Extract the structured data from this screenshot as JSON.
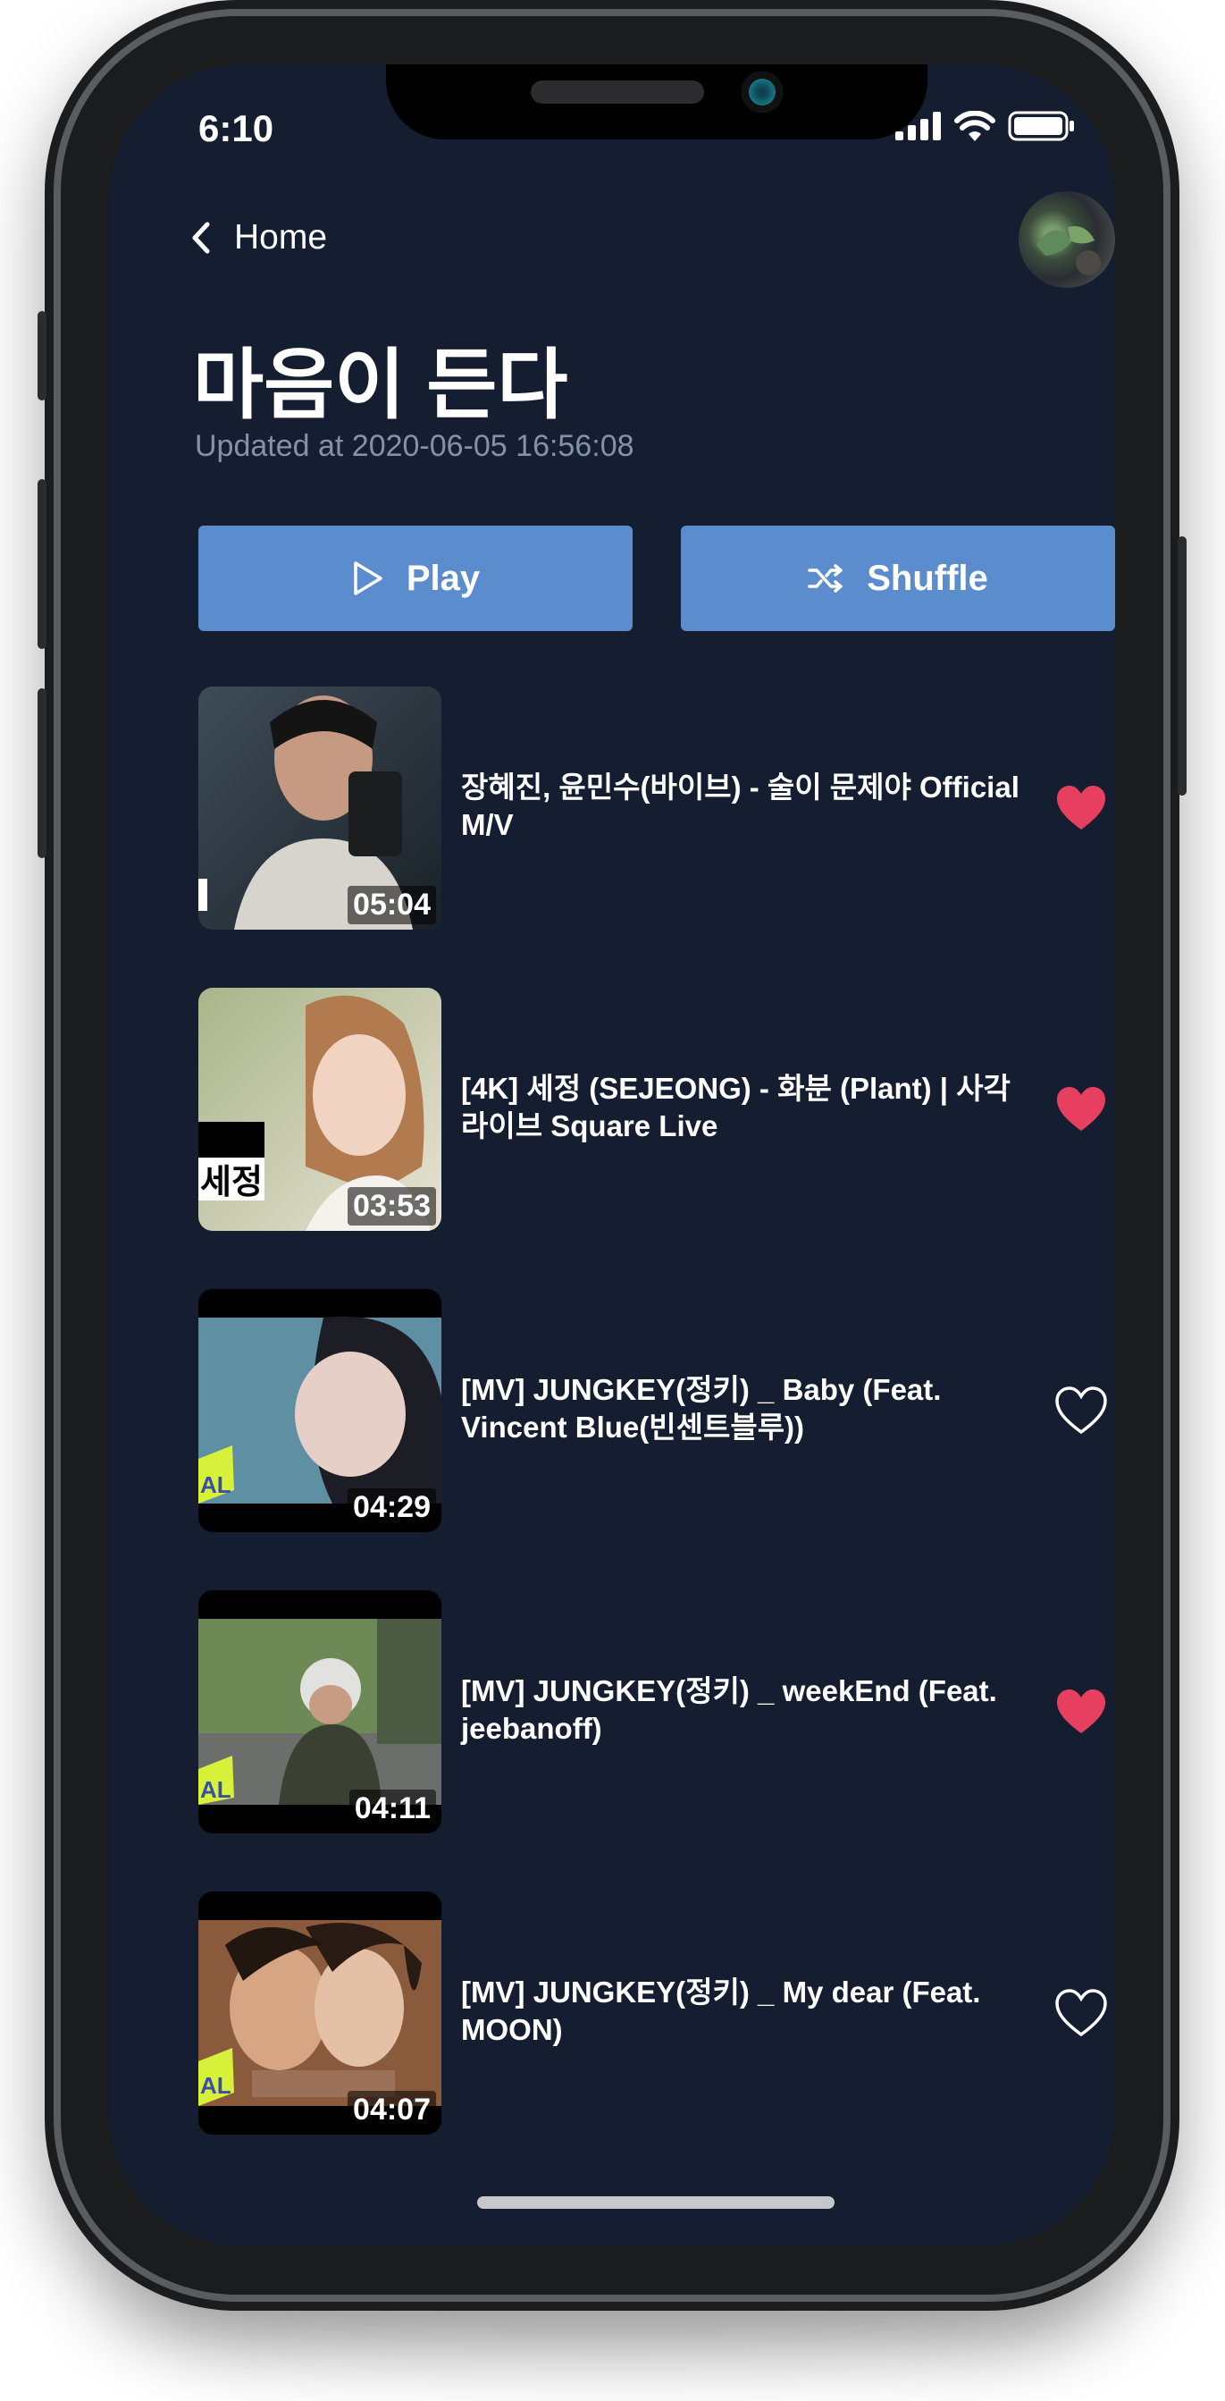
{
  "status_bar": {
    "time": "6:10"
  },
  "header": {
    "back_label": "Home"
  },
  "playlist": {
    "title": "마음이 든다",
    "updated": "Updated at 2020-06-05 16:56:08"
  },
  "actions": {
    "play_label": "Play",
    "shuffle_label": "Shuffle"
  },
  "songs": [
    {
      "title": "장혜진, 윤민수(바이브) - 술이 문제야 Official M/V",
      "duration": "05:04",
      "liked": true
    },
    {
      "title": "[4K] 세정 (SEJEONG) - 화분 (Plant) | 사각라이브 Square Live",
      "duration": "03:53",
      "liked": true,
      "thumb_label": "세정"
    },
    {
      "title": "[MV] JUNGKEY(정키) _ Baby (Feat. Vincent Blue(빈센트블루))",
      "duration": "04:29",
      "liked": false,
      "thumb_label": "AL"
    },
    {
      "title": "[MV] JUNGKEY(정키) _ weekEnd (Feat. jeebanoff)",
      "duration": "04:11",
      "liked": true,
      "thumb_label": "AL"
    },
    {
      "title": "[MV] JUNGKEY(정키) _ My dear (Feat. MOON)",
      "duration": "04:07",
      "liked": false,
      "thumb_label": "AL"
    }
  ],
  "colors": {
    "background": "#141e30",
    "button": "#5b8ccd",
    "heart_active": "#e63f5f",
    "subtitle": "#8591a6"
  },
  "icons": {
    "back": "chevron-left-icon",
    "play": "play-icon",
    "shuffle": "shuffle-icon",
    "like": "heart-icon"
  }
}
